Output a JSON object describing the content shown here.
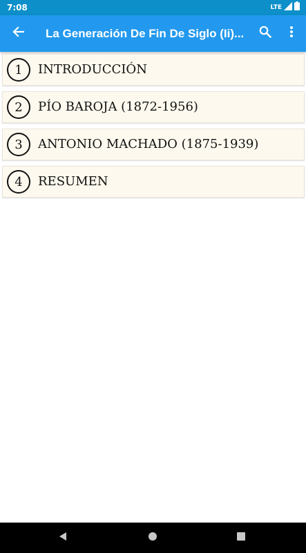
{
  "status_bar": {
    "time": "7:08",
    "network": "LTE",
    "color": "#0d8fc9"
  },
  "app_bar": {
    "title": "La Generación De Fin De Siglo (Ii)...",
    "color": "#2299ee",
    "back_icon": "arrow-back-icon",
    "search_icon": "search-icon",
    "more_icon": "more-vert-icon"
  },
  "list": {
    "background": "#fdf9ee",
    "items": [
      {
        "number": "1",
        "label": "INTRODUCCIÓN"
      },
      {
        "number": "2",
        "label": "PÍO BAROJA (1872-1956)"
      },
      {
        "number": "3",
        "label": "ANTONIO MACHADO (1875-1939)"
      },
      {
        "number": "4",
        "label": "RESUMEN"
      }
    ]
  },
  "nav_bar": {
    "back_icon": "nav-back-icon",
    "home_icon": "nav-home-icon",
    "recents_icon": "nav-recents-icon"
  }
}
